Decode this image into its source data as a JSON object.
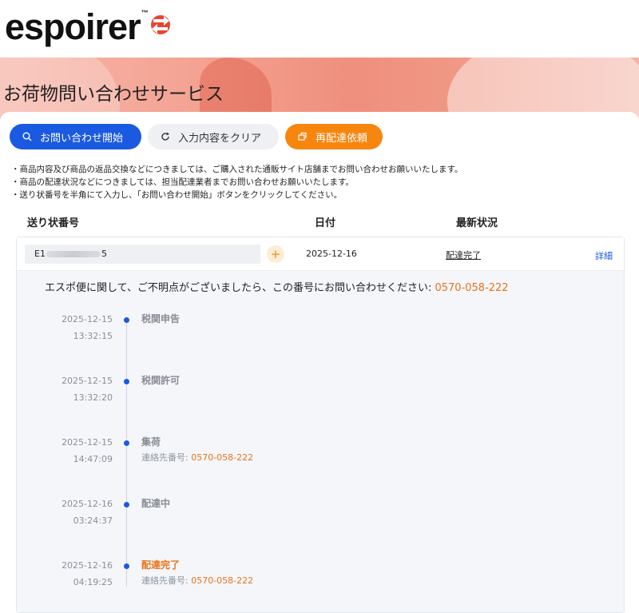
{
  "brand": {
    "name": "espoirer",
    "tm": "™"
  },
  "hero": {
    "title": "お荷物問い合わせサービス"
  },
  "actions": {
    "search_label": "お問い合わせ開始",
    "clear_label": "入力内容をクリア",
    "redelivery_label": "再配達依頼"
  },
  "notes": [
    "・商品内容及び商品の返品交換などにつきましては、ご購入された通販サイト店舗までお問い合わせお願いいたします。",
    "・商品の配達状況などにつきましては、担当配達業者までお問い合わせお願いいたします。",
    "・送り状番号を半角にて入力し、「お問い合わせ開始」ボタンをクリックしてください。"
  ],
  "table": {
    "headers": {
      "tracking": "送り状番号",
      "date": "日付",
      "status": "最新状況"
    },
    "row": {
      "tracking_prefix": "E1",
      "tracking_suffix": "5",
      "add_symbol": "+",
      "date": "2025-12-16",
      "status": "配達完了",
      "detail": "詳細"
    }
  },
  "detail": {
    "inquiry_text": "エスポ便に関して、ご不明点がございましたら、この番号にお問い合わせください: ",
    "inquiry_phone": "0570-058-222",
    "contact_label": "連絡先番号: ",
    "events": [
      {
        "date": "2025-12-15",
        "time": "13:32:15",
        "title": "税関申告",
        "phone": ""
      },
      {
        "date": "2025-12-15",
        "time": "13:32:20",
        "title": "税関許可",
        "phone": ""
      },
      {
        "date": "2025-12-15",
        "time": "14:47:09",
        "title": "集荷",
        "phone": "0570-058-222"
      },
      {
        "date": "2025-12-16",
        "time": "03:24:37",
        "title": "配達中",
        "phone": ""
      },
      {
        "date": "2025-12-16",
        "time": "04:19:25",
        "title": "配達完了",
        "phone": "0570-058-222"
      }
    ]
  },
  "colors": {
    "primary": "#1a5ae0",
    "accent": "#f7860f",
    "brand_red": "#e8452f"
  },
  "icons": [
    "search-icon",
    "refresh-icon",
    "redelivery-icon",
    "plus-icon"
  ]
}
